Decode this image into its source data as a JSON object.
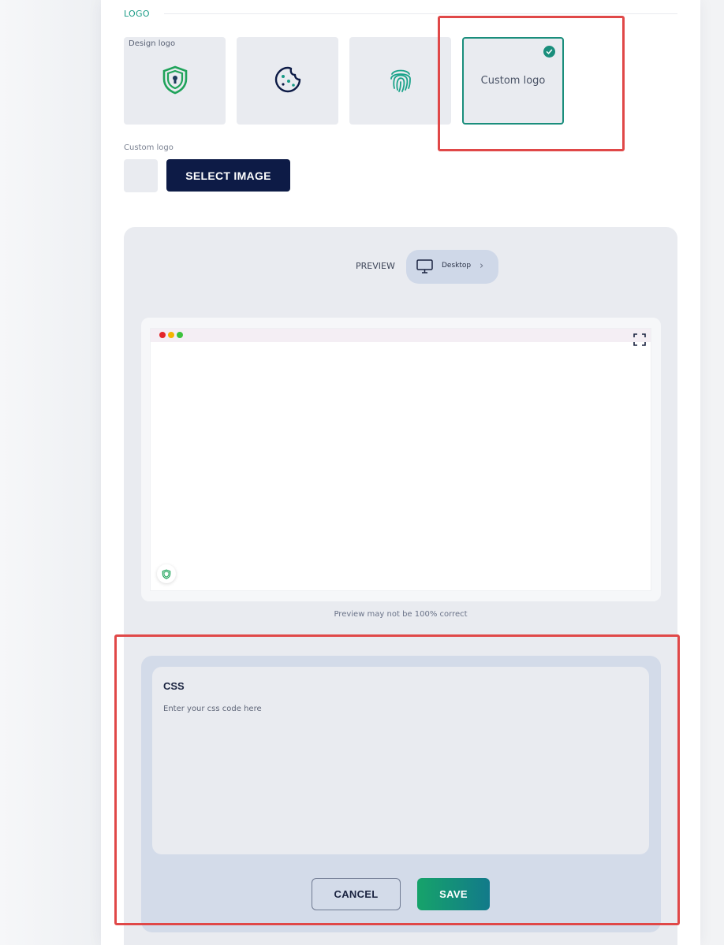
{
  "logo_section": {
    "title": "LOGO",
    "options": [
      {
        "label": "Design logo",
        "icon": "shield-logo-icon"
      },
      {
        "label": "",
        "icon": "cookie-logo-icon"
      },
      {
        "label": "",
        "icon": "fingerprint-logo-icon"
      },
      {
        "label": "Custom logo",
        "icon": "",
        "selected": true
      }
    ],
    "custom_logo_label": "Custom logo",
    "select_image_button": "SELECT IMAGE"
  },
  "preview": {
    "label": "PREVIEW",
    "device": "Desktop",
    "note": "Preview may not be 100% correct"
  },
  "css": {
    "title": "CSS",
    "placeholder": "Enter your css code here"
  },
  "actions": {
    "cancel": "CANCEL",
    "save": "SAVE"
  },
  "colors": {
    "accent": "#1a8e7c",
    "navy": "#0d1b46",
    "highlight": "#e04848"
  }
}
